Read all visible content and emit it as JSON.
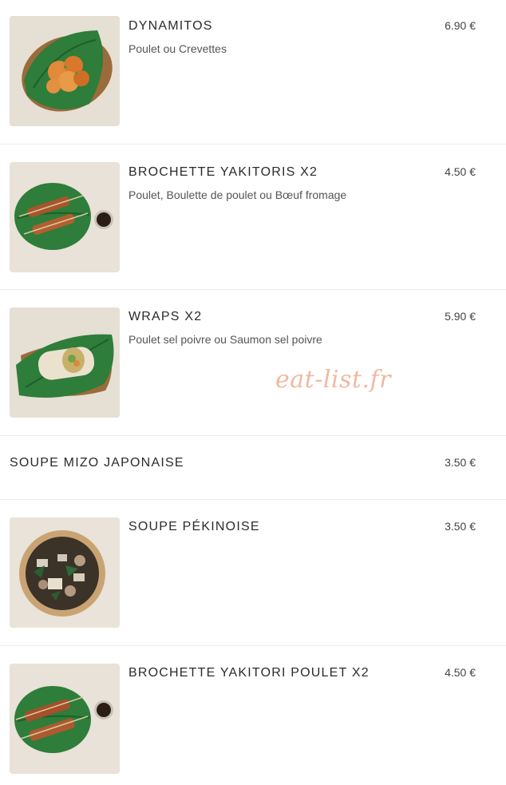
{
  "watermark": "eat-list.fr",
  "items": [
    {
      "title": "DYNAMITOS",
      "description": "Poulet ou Crevettes",
      "price": "6.90 €",
      "image": "dynamitos-photo"
    },
    {
      "title": "BROCHETTE YAKITORIS X2",
      "description": "Poulet, Boulette de poulet ou Bœuf fromage",
      "price": "4.50 €",
      "image": "yakitoris-photo"
    },
    {
      "title": "WRAPS X2",
      "description": "Poulet sel poivre ou Saumon sel poivre",
      "price": "5.90 €",
      "image": "wraps-photo"
    },
    {
      "title": "SOUPE MIZO JAPONAISE",
      "description": "",
      "price": "3.50 €",
      "image": ""
    },
    {
      "title": "SOUPE PÉKINOISE",
      "description": "",
      "price": "3.50 €",
      "image": "soupe-pekinoise-photo"
    },
    {
      "title": "BROCHETTE YAKITORI POULET X2",
      "description": "",
      "price": "4.50 €",
      "image": "yakitori-poulet-photo"
    }
  ],
  "colors": {
    "leaf": "#2e7d3a",
    "leaf_dark": "#1f5f2a",
    "board": "#e3ddd3",
    "watermark": "#f0b9a0"
  }
}
